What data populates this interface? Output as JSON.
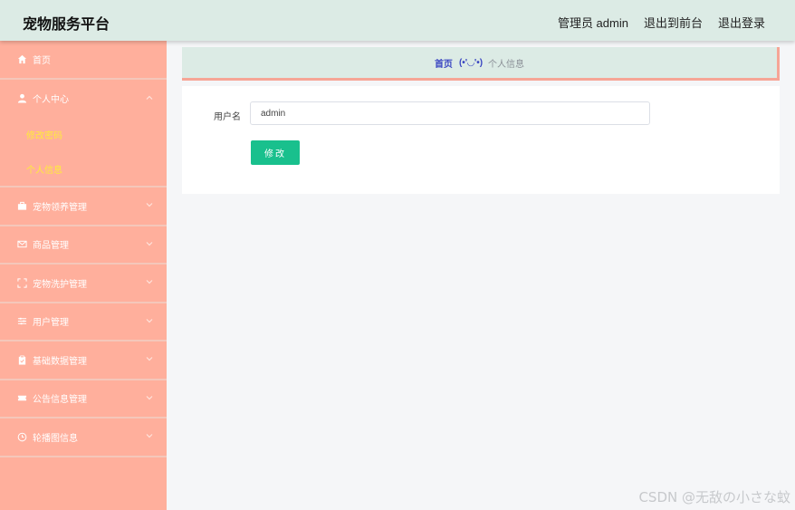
{
  "app_title": "宠物服务平台",
  "header": {
    "user_label": "管理员 admin",
    "back_front_label": "退出到前台",
    "logout_label": "退出登录"
  },
  "sidebar": {
    "items": [
      {
        "label": "首页",
        "icon": "home-icon"
      },
      {
        "label": "个人中心",
        "icon": "user-icon",
        "expanded": true,
        "children": [
          {
            "label": "修改密码"
          },
          {
            "label": "个人信息"
          }
        ]
      },
      {
        "label": "宠物领养管理",
        "icon": "briefcase-icon"
      },
      {
        "label": "商品管理",
        "icon": "mail-icon"
      },
      {
        "label": "宠物洗护管理",
        "icon": "fullscreen-icon"
      },
      {
        "label": "用户管理",
        "icon": "sliders-icon"
      },
      {
        "label": "基础数据管理",
        "icon": "clipboard-icon"
      },
      {
        "label": "公告信息管理",
        "icon": "ticket-icon"
      },
      {
        "label": "轮播图信息",
        "icon": "clock-icon"
      }
    ]
  },
  "breadcrumb": {
    "home": "首页",
    "face": "(•'◡'•)",
    "current": "个人信息"
  },
  "form": {
    "username_label": "用户名",
    "username_value": "admin",
    "submit_label": "修改"
  },
  "colors": {
    "sidebar_bg": "#ffaf9c",
    "header_bg": "#dcebe5",
    "submenu_text": "#ffeb3b",
    "button_bg": "#19c08d",
    "breadcrumb_link": "#3a46c2"
  },
  "watermark": "CSDN @无敌の小さな蚊"
}
